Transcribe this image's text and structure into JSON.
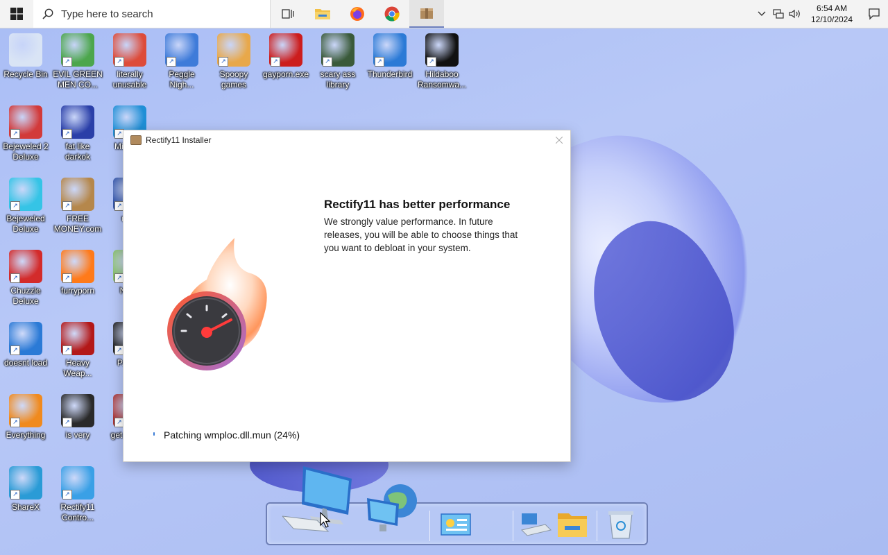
{
  "taskbar": {
    "search_placeholder": "Type here to search",
    "clock_time": "6:54 AM",
    "clock_date": "12/10/2024"
  },
  "desktop_icons": [
    {
      "label": "Recycle Bin",
      "icon": "recycle-bin-icon",
      "color": "#d9e4f5"
    },
    {
      "label": "EVIL GREEN MEN CO...",
      "icon": "green-people-icon",
      "color": "#4ca64c"
    },
    {
      "label": "literally unusable",
      "icon": "chrome-icon",
      "color": "#dd4b39"
    },
    {
      "label": "Peggle Nigh...",
      "icon": "peggle-icon",
      "color": "#3e7bd9"
    },
    {
      "label": "Spoopy games",
      "icon": "folder-icon",
      "color": "#e8a84a"
    },
    {
      "label": "gayporn.exe",
      "icon": "flash-icon",
      "color": "#cc1d1d"
    },
    {
      "label": "scary ass library",
      "icon": "library-icon",
      "color": "#3a5a3a"
    },
    {
      "label": "Thunderbird",
      "icon": "thunderbird-icon",
      "color": "#2b7ad6"
    },
    {
      "label": "Hildaboo Ransomwa...",
      "icon": "ransomware-icon",
      "color": "#111111"
    },
    {
      "label": "Bejeweled 2 Deluxe",
      "icon": "bejeweled2-icon",
      "color": "#d23a3a"
    },
    {
      "label": "fat like darkok",
      "icon": "mpi-icon",
      "color": "#2a3fa8"
    },
    {
      "label": "Bejeweled Deluxe",
      "icon": "diamond-icon",
      "color": "#35c4e6"
    },
    {
      "label": "FREE MONEY.com",
      "icon": "money-bag-icon",
      "color": "#b5874b"
    },
    {
      "label": "Chuzzle Deluxe",
      "icon": "chuzzle-icon",
      "color": "#d32b2b"
    },
    {
      "label": "furryporn",
      "icon": "firefox-icon",
      "color": "#ff7a1a"
    },
    {
      "label": "doesnt load",
      "icon": "thunderbird-icon",
      "color": "#2b7ad6"
    },
    {
      "label": "Heavy Weap...",
      "icon": "radiation-icon",
      "color": "#b31818"
    },
    {
      "label": "Everything",
      "icon": "magnifier-icon",
      "color": "#f08a1e"
    },
    {
      "label": "is very",
      "icon": "shield-icon",
      "color": "#2a2a2a"
    },
    {
      "label": "ShareX",
      "icon": "sharex-icon",
      "color": "#2a9bd6"
    },
    {
      "label": "Rectify11 Contro...",
      "icon": "rectify-control-icon",
      "color": "#3aa0e6"
    },
    {
      "label": "Mi... E...",
      "icon": "edge-icon",
      "color": "#1f8fd6"
    },
    {
      "label": "ne...",
      "icon": "generic-icon",
      "color": "#3355aa"
    },
    {
      "label": "Not...",
      "icon": "notepad-icon",
      "color": "#88c06a"
    },
    {
      "label": "P... P...",
      "icon": "generic-icon",
      "color": "#222222"
    },
    {
      "label": "get l... D...",
      "icon": "generic-icon",
      "color": "#aa3333"
    }
  ],
  "dialog": {
    "title": "Rectify11 Installer",
    "heading": "Rectify11 has better performance",
    "description": "We strongly value performance. In future releases, you will be able to choose things that you want to debloat in your system.",
    "status": "Patching wmploc.dll.mun (24%)"
  },
  "colors": {
    "accent": "#6b7fbf",
    "taskbar_bg": "#f3f3f3",
    "desktop_bg": "#aabcf4"
  }
}
